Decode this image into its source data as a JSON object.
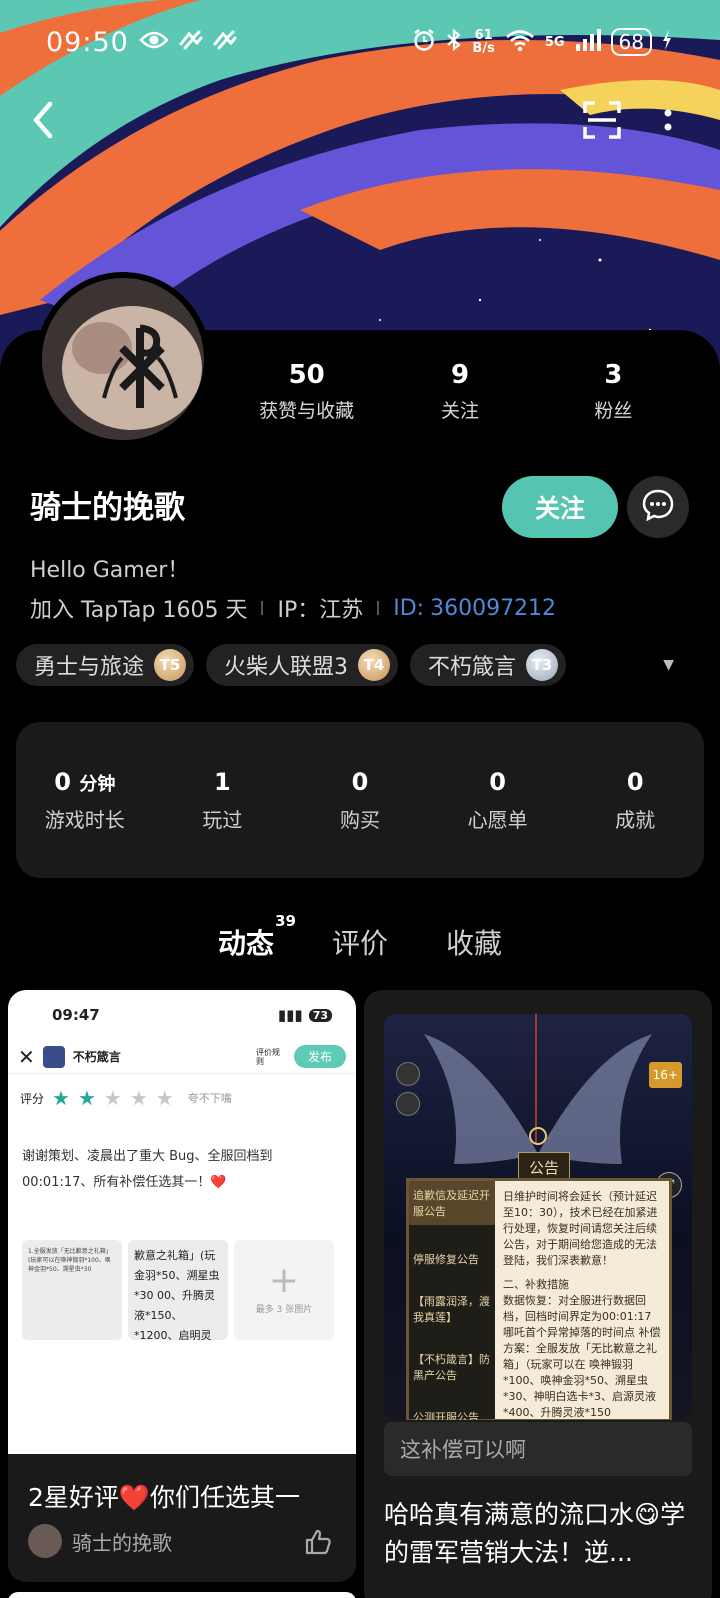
{
  "status_bar": {
    "time": "09:50",
    "net_speed_value": "61",
    "net_speed_unit": "B/s",
    "signal": "5G",
    "battery": "68"
  },
  "profile": {
    "name": "骑士的挽歌",
    "bio": "Hello Gamer！",
    "join_text": "加入 TapTap 1605 天",
    "ip_text": "IP：江苏",
    "id_label": "ID:",
    "id_value": "360097212",
    "stats": [
      {
        "num": "50",
        "label": "获赞与收藏"
      },
      {
        "num": "9",
        "label": "关注"
      },
      {
        "num": "3",
        "label": "粉丝"
      }
    ],
    "follow_label": "关注"
  },
  "badges": [
    {
      "label": "勇士与旅途",
      "medal": "T5",
      "style": "gold"
    },
    {
      "label": "火柴人联盟3",
      "medal": "T4",
      "style": "gold"
    },
    {
      "label": "不朽箴言",
      "medal": "T3",
      "style": "silver"
    }
  ],
  "game_stats": [
    {
      "num": "0",
      "unit": "分钟",
      "label": "游戏时长"
    },
    {
      "num": "1",
      "unit": "",
      "label": "玩过"
    },
    {
      "num": "0",
      "unit": "",
      "label": "购买"
    },
    {
      "num": "0",
      "unit": "",
      "label": "心愿单"
    },
    {
      "num": "0",
      "unit": "",
      "label": "成就"
    }
  ],
  "tabs": [
    {
      "label": "动态",
      "count": "39",
      "active": true
    },
    {
      "label": "评价",
      "count": "",
      "active": false
    },
    {
      "label": "收藏",
      "count": "",
      "active": false
    }
  ],
  "card_left": {
    "shot_time": "09:47",
    "shot_battery": "73",
    "shot_game": "不朽箴言",
    "shot_rules": "评价规则",
    "shot_publish": "发布",
    "shot_rating_label": "评分",
    "shot_rating_text": "夸不下嘴",
    "shot_stars": 2,
    "shot_body": "谢谢策划、凌晨出了重大 Bug、全服回档到 00:01:17、所有补偿任选其一！❤️",
    "thumb1_text": "1.全服发放「无比歉意之礼箱」(玩家可以在唤神锻羽*100、唤神金羽*50、溯星虫*30",
    "thumb2_text": "歉意之礼箱」(玩 金羽*50、溯星虫*30 00、升腾灵液*150、 *1200、启明灵钥*50",
    "add_label": "最多 3 张图片",
    "title": "2星好评❤️你们任选其一",
    "author": "骑士的挽歌"
  },
  "card_right": {
    "notice_tab": "公告",
    "menu": [
      "追歉信及延迟开服公告",
      "停服修复公告",
      "【雨露润泽，渡我真莲】",
      "【不朽箴言】防黑产公告",
      "公测开服公告"
    ],
    "body_top": "日维护时间将会延长（预计延迟至10：30），技术已经在加紧进行处理，恢复时间请您关注后续公告，对于期间给您造成的无法登陆，我们深表歉意！",
    "body_section": "二、补救措施",
    "body_detail": "数据恢复：对全服进行数据回档，回档时间界定为00:01:17 哪吒首个异常掉落的时间点 补偿方案：全服发放「无比歉意之礼箱」（玩家可以在 唤神锻羽*100、唤神金羽*50、溯星虫*30、神明白选卡*3、启源灵液*400、升腾灵液*150",
    "age": "16+",
    "comment": "这补偿可以啊",
    "title": "哈哈真有满意的流口水😋学的雷军营销大法！逆..."
  },
  "colors": {
    "accent": "#55c4b0",
    "id_blue": "#4e8ad6",
    "star_on": "#27a999"
  }
}
